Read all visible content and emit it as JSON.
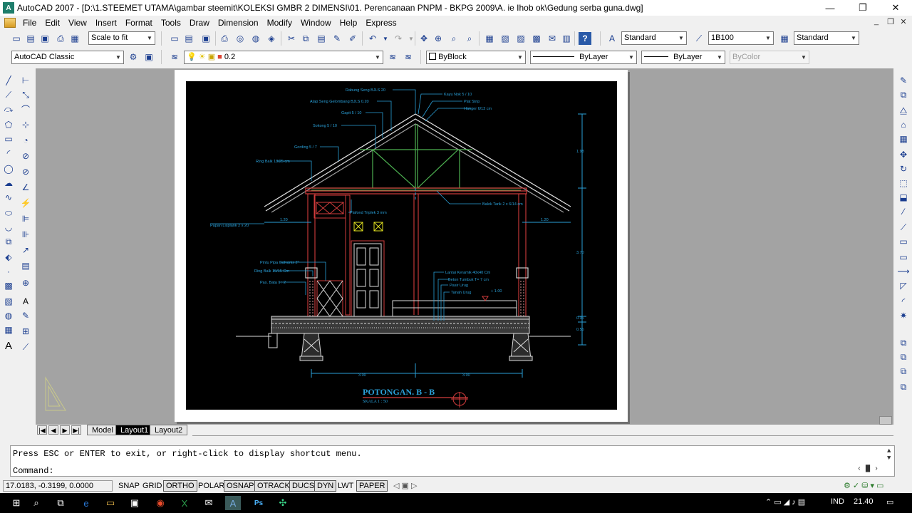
{
  "window": {
    "title": "AutoCAD 2007 - [D:\\1.STEEMET UTAMA\\gambar steemit\\KOLEKSI GMBR 2 DIMENSI\\01. Perencanaan PNPM - BKPG 2009\\A. ie Ihob ok\\Gedung serba guna.dwg]",
    "minimize": "—",
    "restore": "❐",
    "close": "✕",
    "doc_minimize": "_",
    "doc_restore": "❐",
    "doc_close": "✕"
  },
  "menu": [
    "File",
    "Edit",
    "View",
    "Insert",
    "Format",
    "Tools",
    "Draw",
    "Dimension",
    "Modify",
    "Window",
    "Help",
    "Express"
  ],
  "toolbar": {
    "zoom_combo": "Scale to fit",
    "text_style": "Standard",
    "dim_style": "1B100",
    "table_style": "Standard",
    "workspace": "AutoCAD Classic",
    "layer": "0.2",
    "color": "ByBlock",
    "linetype": "ByLayer",
    "lineweight": "ByLayer",
    "plotstyle": "ByColor"
  },
  "tabs": [
    "Model",
    "Layout1",
    "Layout2"
  ],
  "command": {
    "line1": "Press ESC or ENTER to exit, or right-click to display shortcut menu.",
    "prompt": "Command:"
  },
  "status": {
    "coords": "17.0183, -0.3199, 0.0000",
    "buttons": [
      "SNAP",
      "GRID",
      "ORTHO",
      "POLAR",
      "OSNAP",
      "OTRACK",
      "DUCS",
      "DYN",
      "LWT",
      "PAPER"
    ]
  },
  "taskbar": {
    "lang": "IND",
    "time": "21.40"
  },
  "drawing": {
    "title": "POTONGAN. B - B",
    "scale": "SKALA 1 : 50",
    "labels": {
      "rabung": "Rabung Seng BJLS 20",
      "atap": "Atap Seng Gelombang BJLS 0.20",
      "gapit": "Gapit 5 / 10",
      "sokong": "Sokong 5 / 10",
      "gording": "Gording 5 / 7",
      "ring_balk_top": "Ring Balk 18/25 cm",
      "papan_lisplank": "Papan Lisplank 2 x 20",
      "kayu_nok": "Kayu Nok 5 / 10",
      "plat_strip": "Plat Strip",
      "hanger": "Hanger 6/12 cm",
      "plafond": "Plafond Triplek 3 mm",
      "balok_tarik": "Balok Tarik 2 x 6/14 cm",
      "pintu_pipa": "Pintu Pipa Galvanis 2\"",
      "ring_balk_low": "Ring Balk 15/15 Cm",
      "pas_bata": "Pas. Bata 1 : 2",
      "lantai": "Lantai Keramik 40x40 Cm",
      "beton": "Beton Tumbuk T= 7 cm",
      "pasir": "Pasir Urug",
      "tanah": "Tanah Urug",
      "elev": "+ 1.00"
    },
    "dims": {
      "overhang": "1.20",
      "h_roof": "1.98",
      "h_wall": "3.70",
      "h_base1": "0.05",
      "h_base2": "0.55",
      "span1": "3.00",
      "span2": "3.00"
    }
  }
}
